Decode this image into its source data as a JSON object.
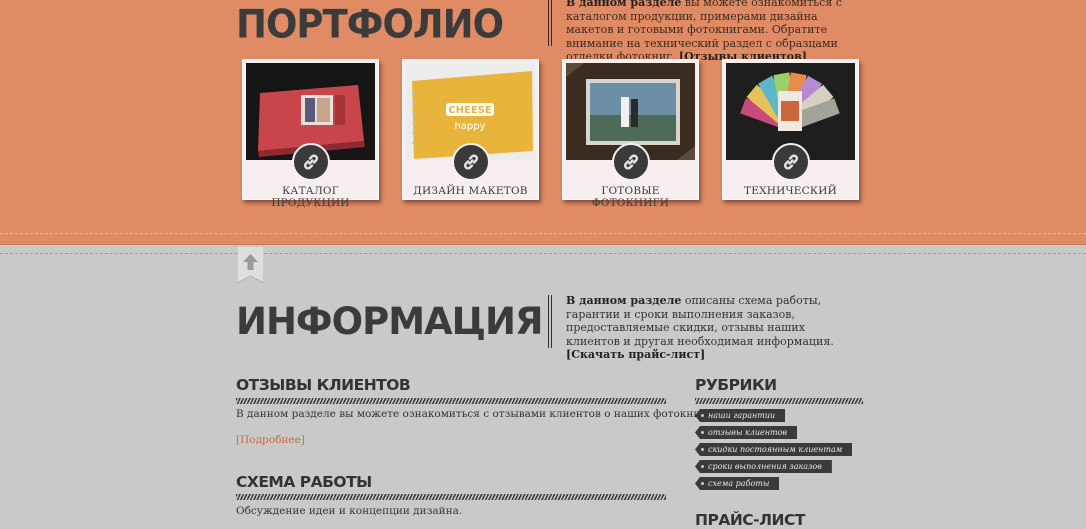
{
  "portfolio": {
    "title": "ПОРТФОЛИО",
    "desc_lead": "В данном разделе",
    "desc_text": " вы можете ознакомиться с каталогом продукции, примерами дизайна макетов и готовыми фотокнигами. Обратите внимание на технический раздел с образцами отделки фотокниг.",
    "desc_link": "[Отзывы клиентов]",
    "cards": [
      {
        "label": "КАТАЛОГ ПРОДУКЦИИ",
        "icon": "link-icon"
      },
      {
        "label": "ДИЗАЙН МАКЕТОВ",
        "icon": "link-icon",
        "photo_text_1": "CHEESE",
        "photo_text_2": "happy"
      },
      {
        "label": "ГОТОВЫЕ ФОТОКНИГИ",
        "icon": "link-icon"
      },
      {
        "label": "ТЕХНИЧЕСКИЙ",
        "icon": "link-icon"
      }
    ]
  },
  "info": {
    "title": "ИНФОРМАЦИЯ",
    "desc_lead": "В данном разделе",
    "desc_text": " описаны схема работы, гарантии и сроки выполнения заказов, предоставляемые скидки, отзывы наших клиентов и другая необходимая информация.",
    "desc_link": "[Скачать прайс-лист]",
    "reviews": {
      "heading": "ОТЗЫВЫ КЛИЕНТОВ",
      "text": "В данном разделе вы можете ознакомиться с отзывами клиентов о наших фотокнигах.",
      "more": "[Подробнее]"
    },
    "scheme": {
      "heading": "СХЕМА РАБОТЫ",
      "text": "Обсуждение идеи и концепции дизайна."
    },
    "rubrics": {
      "heading": "РУБРИКИ",
      "tags": [
        "наши гарантии",
        "отзывы клиентов",
        "скидки постоянным клиентам",
        "сроки выполнения заказов",
        "схема работы"
      ]
    },
    "pricelist": {
      "heading": "ПРАЙС-ЛИСТ"
    }
  },
  "colors": {
    "portfolio_bg": "#e08a63",
    "info_bg": "#c9c9c9",
    "heading": "#3b3b3b",
    "link_accent": "#c96b40"
  }
}
